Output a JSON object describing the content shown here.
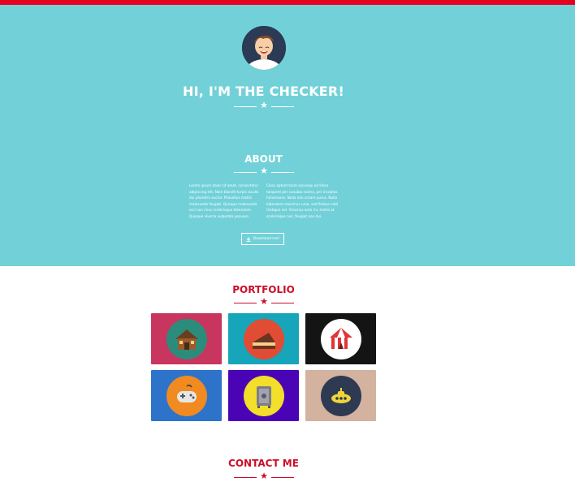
{
  "hero": {
    "title": "HI, I'M THE CHECKER!"
  },
  "about": {
    "title": "ABOUT",
    "left_paragraph": "Lorem ipsum dolor sit amet, consectetur adipiscing elit. Nam blandit turpis iaculis dui pharetra auctor. Phasellus mattis malesuada feugiat. Quisque malesuada orci non risus scelerisque bibendum. Quisque viverra vulputate posuere.",
    "right_paragraph": "Class aptent taciti sociosqu ad litora torquent per conubia nostra, per inceptos himenaeos. Nulla non ornare purus. Nulla bibendum maximus urna, sed finibus velit tristique vel. Vivamus ante mi, mollis at scelerisque nec, feugiat non dui.",
    "download_button": "Download me!"
  },
  "portfolio": {
    "title": "PORTFOLIO",
    "tiles": [
      {
        "name": "cabin",
        "bg": "#c8355f",
        "circle": "#2c8c7b"
      },
      {
        "name": "cake",
        "bg": "#16a5b9",
        "circle": "#e14c34"
      },
      {
        "name": "circus-tent",
        "bg": "#141414",
        "circle": "#ffffff"
      },
      {
        "name": "game-controller",
        "bg": "#2d73c9",
        "circle": "#f08a21"
      },
      {
        "name": "safe",
        "bg": "#4a04b5",
        "circle": "#f3de29"
      },
      {
        "name": "submarine",
        "bg": "#d3b29f",
        "circle": "#2e3a52"
      }
    ]
  },
  "contact": {
    "title": "CONTACT ME"
  },
  "colors": {
    "accent_red": "#cc0d2a",
    "hero_bg": "#72d1d8",
    "top_bar": "#e8001f"
  }
}
